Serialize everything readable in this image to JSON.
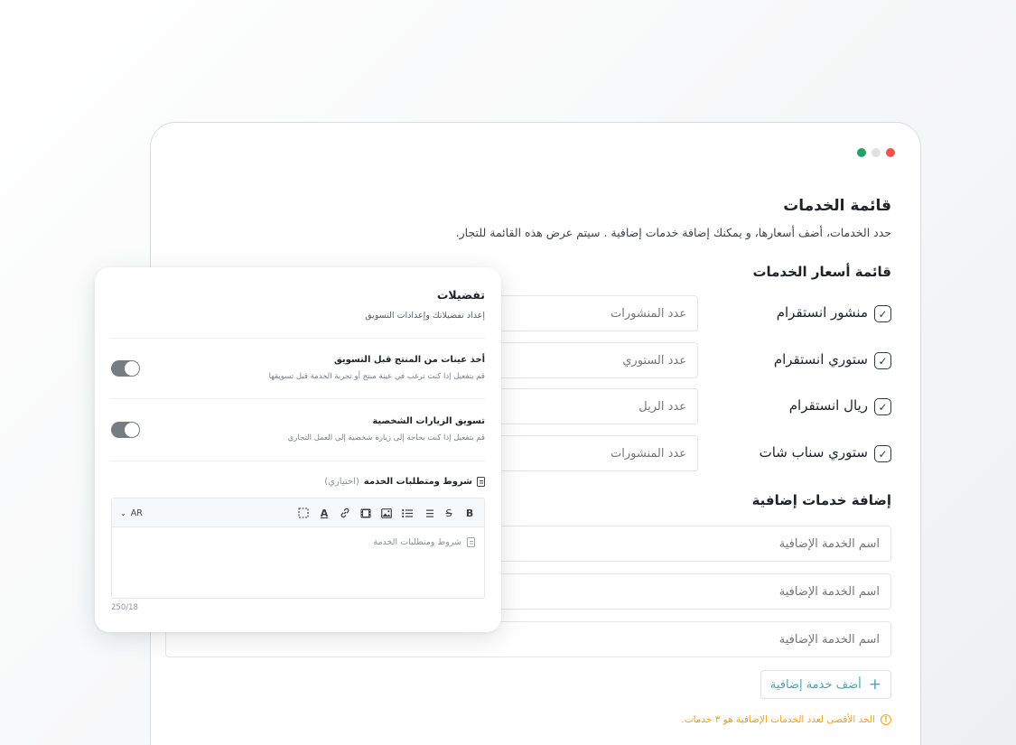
{
  "window": {
    "dots": [
      {
        "name": "close-dot",
        "color": "#ef5350"
      },
      {
        "name": "minimize-dot",
        "color": "#e0e2e4"
      },
      {
        "name": "maximize-dot",
        "color": "#21a366"
      }
    ]
  },
  "page": {
    "title": "قائمة الخدمات",
    "description": "حدد الخدمات، أضف أسعارها، و يمكنك إضافة خدمات إضافية . سيتم عرض هذه القائمة للتجار."
  },
  "pricing": {
    "title": "قائمة أسعار الخدمات",
    "items": [
      {
        "label": "منشور انستقرام",
        "placeholder": "عدد المنشورات",
        "checked": true
      },
      {
        "label": "ستوري انستقرام",
        "placeholder": "عدد الستوري",
        "checked": true
      },
      {
        "label": "ريال انستقرام",
        "placeholder": "عدد الريل",
        "checked": true
      },
      {
        "label": "ستوري سناب شات",
        "placeholder": "عدد المنشورات",
        "checked": true
      }
    ]
  },
  "addons": {
    "title": "إضافة خدمات إضافية",
    "fields": [
      {
        "placeholder": "اسم الخدمة الإضافية"
      },
      {
        "placeholder": "اسم الخدمة الإضافية"
      },
      {
        "placeholder": "اسم الخدمة الإضافية"
      }
    ],
    "add_button": "أضف خدمة إضافية",
    "limit_note": "الحد الأقصى لعدد الخدمات الإضافية هو ٣ خدمات."
  },
  "preferences": {
    "title": "تفضيلات",
    "subtitle": "إعداد تفضيلاتك وإعدادات التسويق",
    "items": [
      {
        "title": "أخذ عينات من المنتج قبل التسويق",
        "description": "قم بتفعيل إذا كنت ترغب في عينة منتج أو تجربة الخدمة قبل تسويقها",
        "enabled": false
      },
      {
        "title": "تسويق الزيارات الشخصية",
        "description": "قم بتفعيل إذا كنت بحاجة إلى زيارة شخصية إلى العمل التجاري",
        "enabled": false
      }
    ],
    "terms": {
      "label": "شروط ومتطلبات الخدمة",
      "optional": "(اختياري)",
      "editor_placeholder": "شروط ومتطلبات الخدمة",
      "language": "AR",
      "counter": "250/18",
      "tools": [
        "bold-icon",
        "strikethrough-icon",
        "numbered-list-icon",
        "bullet-list-icon",
        "image-icon",
        "video-icon",
        "link-icon",
        "text-color-icon",
        "clear-format-icon"
      ]
    }
  }
}
